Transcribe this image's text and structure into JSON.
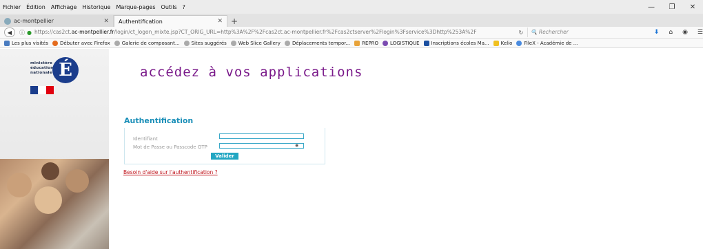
{
  "menubar": {
    "items": [
      "Fichier",
      "Édition",
      "Affichage",
      "Historique",
      "Marque-pages",
      "Outils",
      "?"
    ]
  },
  "tabs": [
    {
      "label": "ac-montpellier",
      "active": false
    },
    {
      "label": "Authentification",
      "active": true
    }
  ],
  "nav": {
    "url_prefix": "https://cas2ct.",
    "url_domain": "ac-montpellier.fr",
    "url_rest": "/login/ct_logon_mixte.jsp?CT_ORIG_URL=http%3A%2F%2Fcas2ct.ac-montpellier.fr%2Fcas2ctserver%2Flogin%3Fservice%3Dhttp%253A%2F",
    "search_placeholder": "Rechercher"
  },
  "bookmarks": [
    "Les plus visités",
    "Débuter avec Firefox",
    "Galerie de composant...",
    "Sites suggérés",
    "Web Slice Gallery",
    "Déplacements tempor...",
    "REPRO",
    "LOGISTIQUE",
    "Inscriptions écoles Ma...",
    "Kelio",
    "FileX - Académie de ..."
  ],
  "page": {
    "logo_lines": [
      "ministère",
      "éducation",
      "nationale"
    ],
    "tagline": "accédez à vos applications",
    "auth_title": "Authentification",
    "field_identifiant": "Identifiant",
    "field_password": "Mot de Passe ou Passcode OTP",
    "validate_label": "Valider",
    "help_link": "Besoin d'aide sur l'authentification ?"
  },
  "colors": {
    "tagline": "#7a1a8a",
    "auth_title": "#1b8fb8",
    "button": "#22a6c2",
    "help_link": "#c0141c"
  }
}
